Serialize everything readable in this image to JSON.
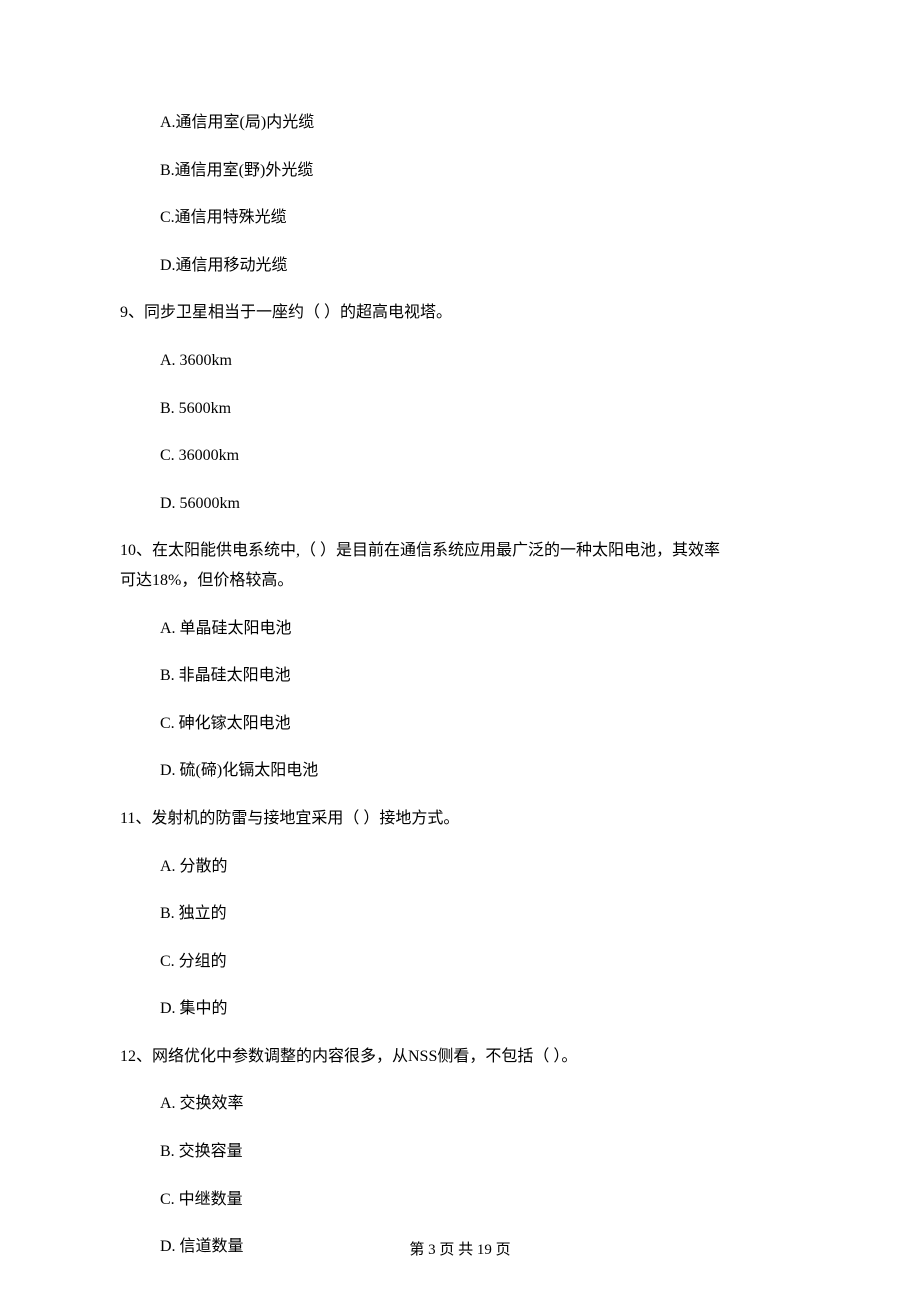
{
  "options_pre": [
    "A.通信用室(局)内光缆",
    "B.通信用室(野)外光缆",
    "C.通信用特殊光缆",
    "D.通信用移动光缆"
  ],
  "q9": {
    "text": "9、同步卫星相当于一座约（    ）的超高电视塔。",
    "options": [
      "A.  3600km",
      "B.  5600km",
      "C.  36000km",
      "D.  56000km"
    ]
  },
  "q10": {
    "text_line1": "10、在太阳能供电系统中,（    ）是目前在通信系统应用最广泛的一种太阳电池，其效率",
    "text_line2": "可达18%，但价格较高。",
    "options": [
      "A.  单晶硅太阳电池",
      "B.  非晶硅太阳电池",
      "C.  砷化镓太阳电池",
      "D.  硫(碲)化镉太阳电池"
    ]
  },
  "q11": {
    "text": "11、发射机的防雷与接地宜采用（    ）接地方式。",
    "options": [
      "A.  分散的",
      "B.  独立的",
      "C.  分组的",
      "D.  集中的"
    ]
  },
  "q12": {
    "text": "12、网络优化中参数调整的内容很多，从NSS侧看，不包括（    ）。",
    "options": [
      "A.  交换效率",
      "B.  交换容量",
      "C.  中继数量",
      "D.  信道数量"
    ]
  },
  "footer": "第 3 页 共 19 页"
}
